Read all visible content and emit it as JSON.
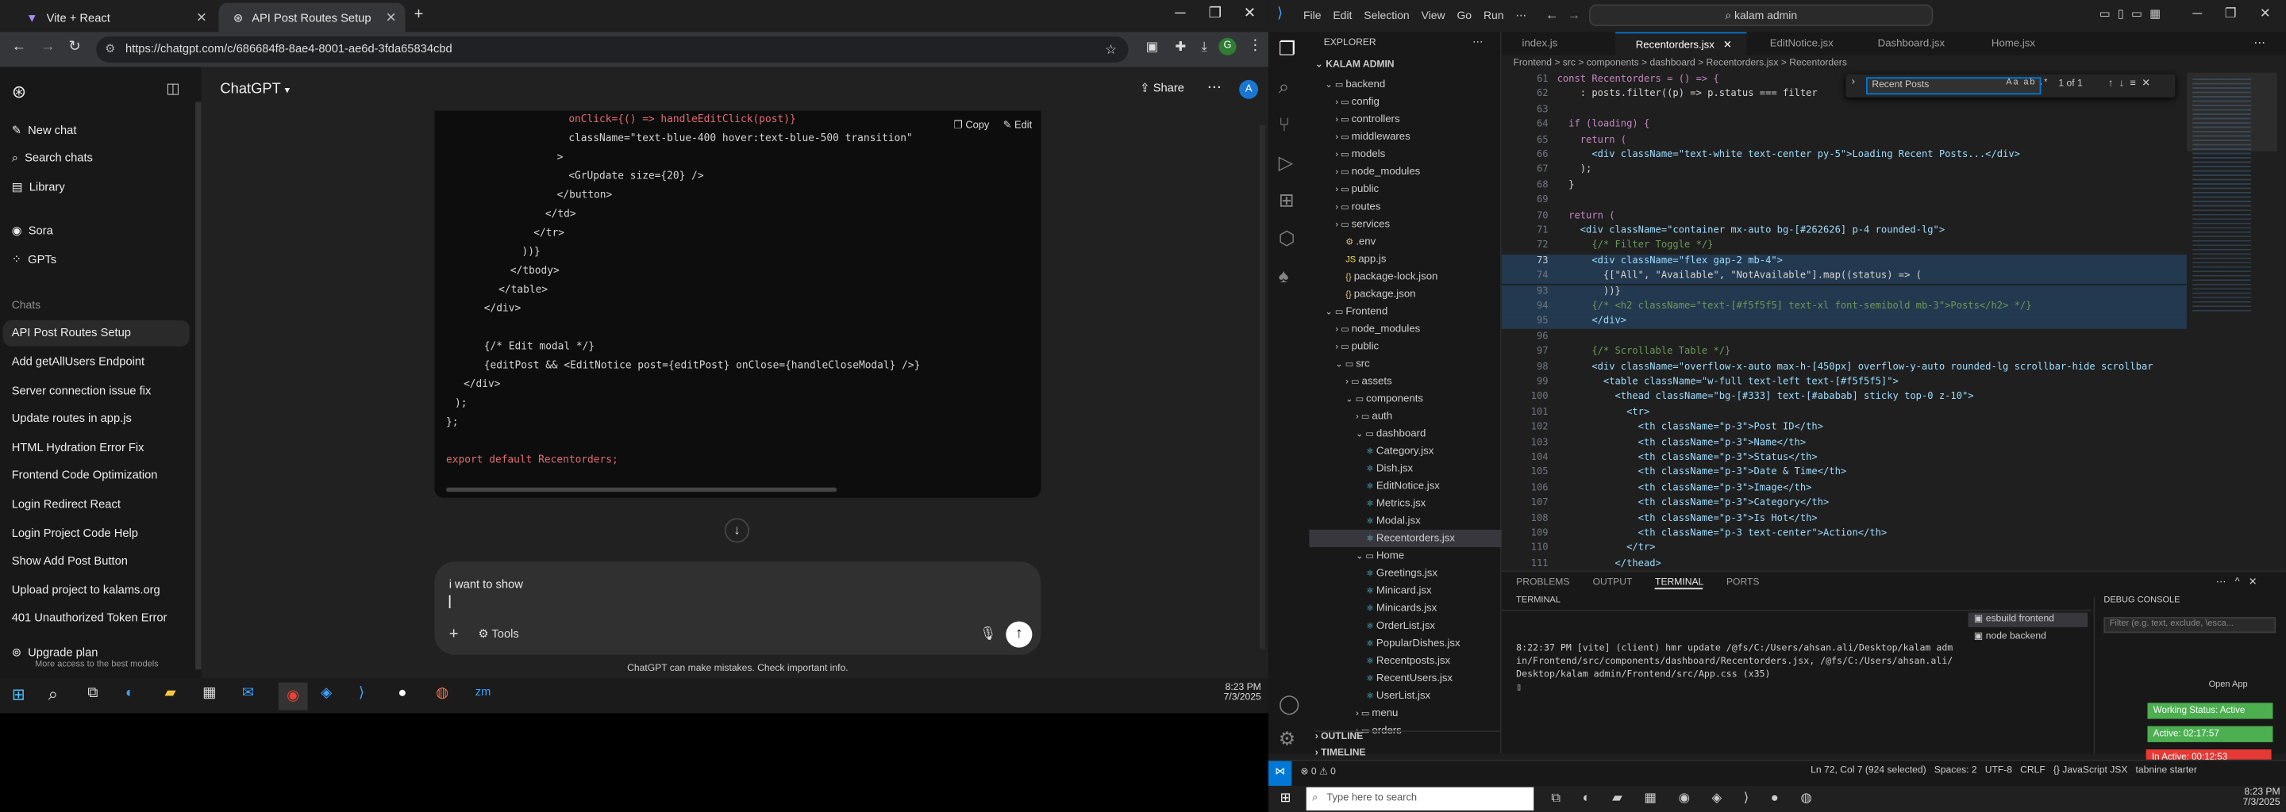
{
  "browser": {
    "tabs": [
      {
        "title": "Vite + React"
      },
      {
        "title": "API Post Routes Setup"
      }
    ],
    "url": "https://chatgpt.com/c/686684f8-8ae4-8001-ae6d-3fda65834cbd"
  },
  "chatgpt": {
    "brand": "ChatGPT",
    "share": "Share",
    "avatar": "A",
    "top_items": [
      {
        "label": "New chat"
      },
      {
        "label": "Search chats"
      },
      {
        "label": "Library"
      },
      {
        "label": "Sora"
      },
      {
        "label": "GPTs"
      }
    ],
    "chats_heading": "Chats",
    "chats": [
      "API Post Routes Setup",
      "Add getAllUsers Endpoint",
      "Server connection issue fix",
      "Update routes in app.js",
      "HTML Hydration Error Fix",
      "Frontend Code Optimization",
      "Login Redirect React",
      "Login Project Code Help",
      "Show Add Post Button",
      "Upload project to kalams.org",
      "401 Unauthorized Token Error"
    ],
    "upgrade_title": "Upgrade plan",
    "upgrade_sub": "More access to the best models",
    "copy": "Copy",
    "edit": "Edit",
    "code": [
      "onClick={() => handleEditClick(post)}",
      "className=\"text-blue-400 hover:text-blue-500 transition\"",
      ">",
      "<GrUpdate size={20} />",
      "</button>",
      "</td>",
      "</tr>",
      "))}",
      "</tbody>",
      "</table>",
      "</div>",
      "",
      "{/* Edit modal */}",
      "{editPost && <EditNotice post={editPost} onClose={handleCloseModal} />}",
      "</div>",
      ");",
      "};",
      "",
      "export default Recentorders;"
    ],
    "composer_text": "i want to show",
    "tools": "Tools",
    "disclaimer": "ChatGPT can make mistakes. Check important info."
  },
  "taskbar_left": {
    "time": "8:23 PM",
    "date": "7/3/2025"
  },
  "vscode": {
    "search": "kalam admin",
    "explorer_title": "EXPLORER",
    "workspace": "KALAM ADMIN",
    "tree": [
      "backend",
      "config",
      "controllers",
      "middlewares",
      "models",
      "node_modules",
      "public",
      "routes",
      "services",
      ".env",
      "app.js",
      "package-lock.json",
      "package.json",
      "Frontend",
      "node_modules",
      "public",
      "src",
      "assets",
      "components",
      "auth",
      "dashboard",
      "Category.jsx",
      "Dish.jsx",
      "EditNotice.jsx",
      "Metrics.jsx",
      "Modal.jsx",
      "Recentorders.jsx",
      "Home",
      "Greetings.jsx",
      "Minicard.jsx",
      "Minicards.jsx",
      "OrderList.jsx",
      "PopularDishes.jsx",
      "Recentposts.jsx",
      "RecentUsers.jsx",
      "UserList.jsx",
      "menu",
      "orders"
    ],
    "outline": "OUTLINE",
    "timeline": "TIMELINE",
    "tabs": [
      "index.js",
      "Recentorders.jsx",
      "EditNotice.jsx",
      "Dashboard.jsx",
      "Home.jsx"
    ],
    "breadcrumb": "Frontend > src > components > dashboard > Recentorders.jsx > Recentorders",
    "find_text": "Recent Posts",
    "find_count": "1 of 1",
    "lines": [
      {
        "n": "61",
        "t": "const Recentorders = () => {"
      },
      {
        "n": "62",
        "t": "    : posts.filter((p) => p.status === filter"
      },
      {
        "n": "63",
        "t": ""
      },
      {
        "n": "64",
        "t": "  if (loading) {"
      },
      {
        "n": "65",
        "t": "    return ("
      },
      {
        "n": "66",
        "t": "      <div className=\"text-white text-center py-5\">Loading Recent Posts...</div>"
      },
      {
        "n": "67",
        "t": "    );"
      },
      {
        "n": "68",
        "t": "  }"
      },
      {
        "n": "69",
        "t": ""
      },
      {
        "n": "70",
        "t": "  return ("
      },
      {
        "n": "71",
        "t": "    <div className=\"container mx-auto bg-[#262626] p-4 rounded-lg\">"
      },
      {
        "n": "72",
        "t": "      {/* Filter Toggle */}"
      },
      {
        "n": "73",
        "t": "      <div className=\"flex gap-2 mb-4\">"
      },
      {
        "n": "74",
        "t": "        {[\"All\", \"Available\", \"NotAvailable\"].map((status) => ("
      },
      {
        "n": "93",
        "t": "        ))}"
      },
      {
        "n": "94",
        "t": "      {/* <h2 className=\"text-[#f5f5f5] text-xl font-semibold mb-3\">Posts</h2> */}"
      },
      {
        "n": "95",
        "t": "      </div>"
      },
      {
        "n": "96",
        "t": ""
      },
      {
        "n": "97",
        "t": "      {/* Scrollable Table */}"
      },
      {
        "n": "98",
        "t": "      <div className=\"overflow-x-auto max-h-[450px] overflow-y-auto rounded-lg scrollbar-hide scrollbar"
      },
      {
        "n": "99",
        "t": "        <table className=\"w-full text-left text-[#f5f5f5]\">"
      },
      {
        "n": "100",
        "t": "          <thead className=\"bg-[#333] text-[#ababab] sticky top-0 z-10\">"
      },
      {
        "n": "101",
        "t": "            <tr>"
      },
      {
        "n": "102",
        "t": "              <th className=\"p-3\">Post ID</th>"
      },
      {
        "n": "103",
        "t": "              <th className=\"p-3\">Name</th>"
      },
      {
        "n": "104",
        "t": "              <th className=\"p-3\">Status</th>"
      },
      {
        "n": "105",
        "t": "              <th className=\"p-3\">Date & Time</th>"
      },
      {
        "n": "106",
        "t": "              <th className=\"p-3\">Image</th>"
      },
      {
        "n": "107",
        "t": "              <th className=\"p-3\">Category</th>"
      },
      {
        "n": "108",
        "t": "              <th className=\"p-3\">Is Hot</th>"
      },
      {
        "n": "109",
        "t": "              <th className=\"p-3 text-center\">Action</th>"
      },
      {
        "n": "110",
        "t": "            </tr>"
      },
      {
        "n": "111",
        "t": "          </thead>"
      }
    ],
    "panel_tabs": [
      "PROBLEMS",
      "OUTPUT",
      "TERMINAL",
      "PORTS"
    ],
    "terminal_label": "TERMINAL",
    "terminal_lines": [
      "8:22:37 PM [vite] (client) hmr update /@fs/C:/Users/ahsan.ali/Desktop/kalam adm",
      "in/Frontend/src/components/dashboard/Recentorders.jsx, /@fs/C:/Users/ahsan.ali/",
      "Desktop/kalam admin/Frontend/src/App.css (x35)"
    ],
    "terminals": [
      "esbuild frontend",
      "node backend"
    ],
    "debug_console": "DEBUG CONSOLE",
    "debug_filter": "Filter (e.g. text, exclude, \\esca...",
    "open_app": "Open App",
    "working_status": "Working Status: Active",
    "active_time": "Active: 02:17:57",
    "inactive_time": "In Active: 00:12:53",
    "status_left": "⊗ 0 ⚠ 0",
    "status_pos": "Ln 72, Col 7 (924 selected)",
    "status_spaces": "Spaces: 2",
    "status_enc": "UTF-8",
    "status_eol": "CRLF",
    "status_lang": "{} JavaScript JSX",
    "status_tabnine": "tabnine starter"
  },
  "windows_taskbar": {
    "search_placeholder": "Type here to search",
    "time": "8:23 PM",
    "date": "7/3/2025"
  }
}
